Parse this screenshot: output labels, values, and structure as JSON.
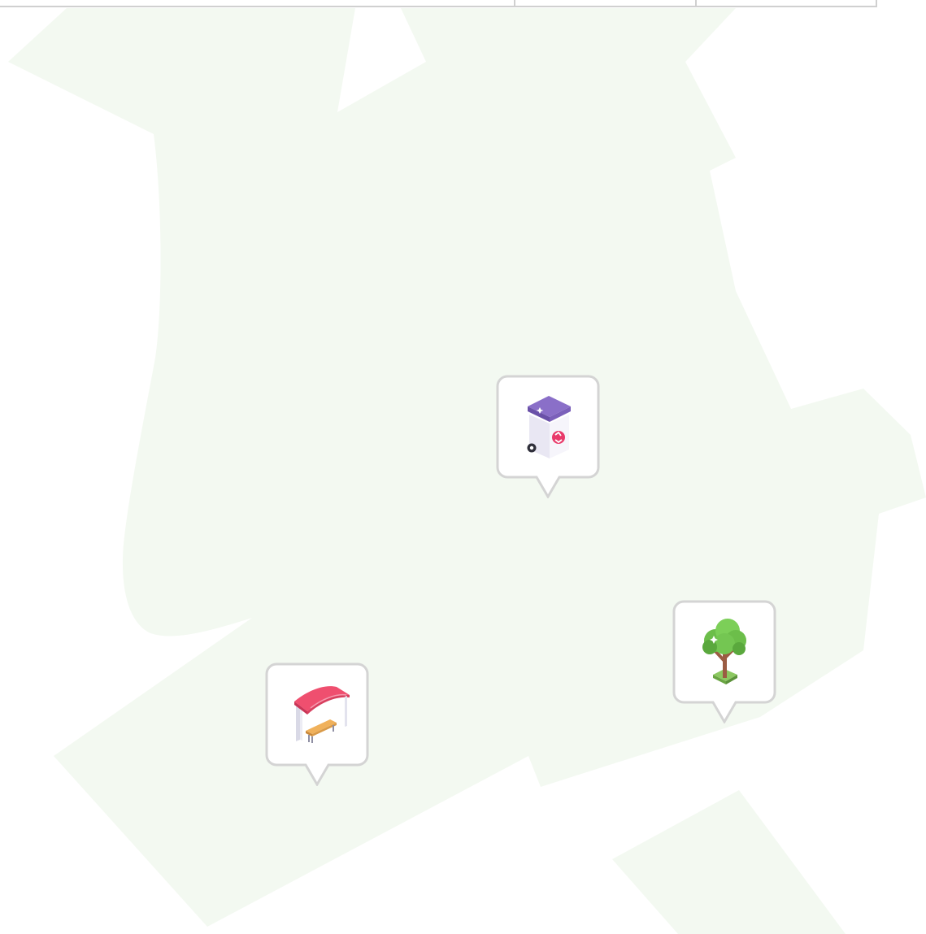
{
  "map": {
    "area_fill": "#f3f9f1",
    "grid_line_color": "#d0d0d0",
    "markers": [
      {
        "id": "recycling-bin",
        "icon": "recycling-bin-icon"
      },
      {
        "id": "tree",
        "icon": "tree-icon"
      },
      {
        "id": "bus-shelter",
        "icon": "bus-shelter-icon"
      }
    ],
    "marker_style": {
      "fill": "#ffffff",
      "border": "#d4d4d4"
    }
  }
}
